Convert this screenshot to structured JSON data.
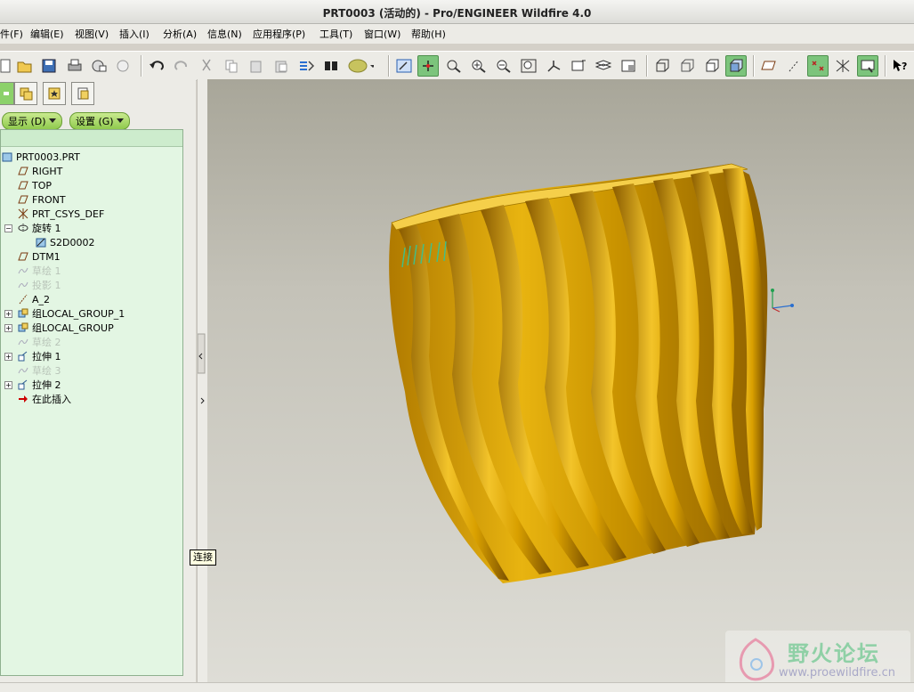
{
  "window": {
    "title": "PRT0003 (活动的) - Pro/ENGINEER Wildfire 4.0"
  },
  "menu": {
    "items": [
      "件(F)",
      "编辑(E)",
      "视图(V)",
      "插入(I)",
      "分析(A)",
      "信息(N)",
      "应用程序(P)",
      "工具(T)",
      "窗口(W)",
      "帮助(H)"
    ]
  },
  "left_panel": {
    "show_label": "显示 (D)",
    "settings_label": "设置 (G)"
  },
  "tree": {
    "items": [
      {
        "label": "PRT0003.PRT",
        "icon": "part-icon"
      },
      {
        "label": "RIGHT",
        "icon": "datum-plane-icon"
      },
      {
        "label": "TOP",
        "icon": "datum-plane-icon"
      },
      {
        "label": "FRONT",
        "icon": "datum-plane-icon"
      },
      {
        "label": "PRT_CSYS_DEF",
        "icon": "csys-icon"
      },
      {
        "label": "旋转 1",
        "icon": "revolve-icon"
      },
      {
        "label": "S2D0002",
        "icon": "sketch-icon"
      },
      {
        "label": "DTM1",
        "icon": "datum-plane-icon"
      },
      {
        "label": "草绘 1",
        "icon": "sketch-curve-icon"
      },
      {
        "label": "投影 1",
        "icon": "projection-icon"
      },
      {
        "label": "A_2",
        "icon": "axis-icon"
      },
      {
        "label": "组LOCAL_GROUP_1",
        "icon": "group-icon"
      },
      {
        "label": "组LOCAL_GROUP",
        "icon": "group-icon"
      },
      {
        "label": "草绘 2",
        "icon": "sketch-curve-icon"
      },
      {
        "label": "拉伸 1",
        "icon": "extrude-icon"
      },
      {
        "label": "草绘 3",
        "icon": "sketch-curve-icon"
      },
      {
        "label": "拉伸 2",
        "icon": "extrude-icon"
      },
      {
        "label": "在此插入",
        "icon": "insert-here-icon"
      }
    ]
  },
  "tooltip": {
    "text": "连接"
  },
  "watermark": {
    "brand": "野火论坛",
    "url": "www.proewildfire.cn"
  },
  "colors": {
    "model_gold": "#d9a000",
    "tree_bg": "#e3f6e3",
    "active_button": "#7cc47c"
  }
}
